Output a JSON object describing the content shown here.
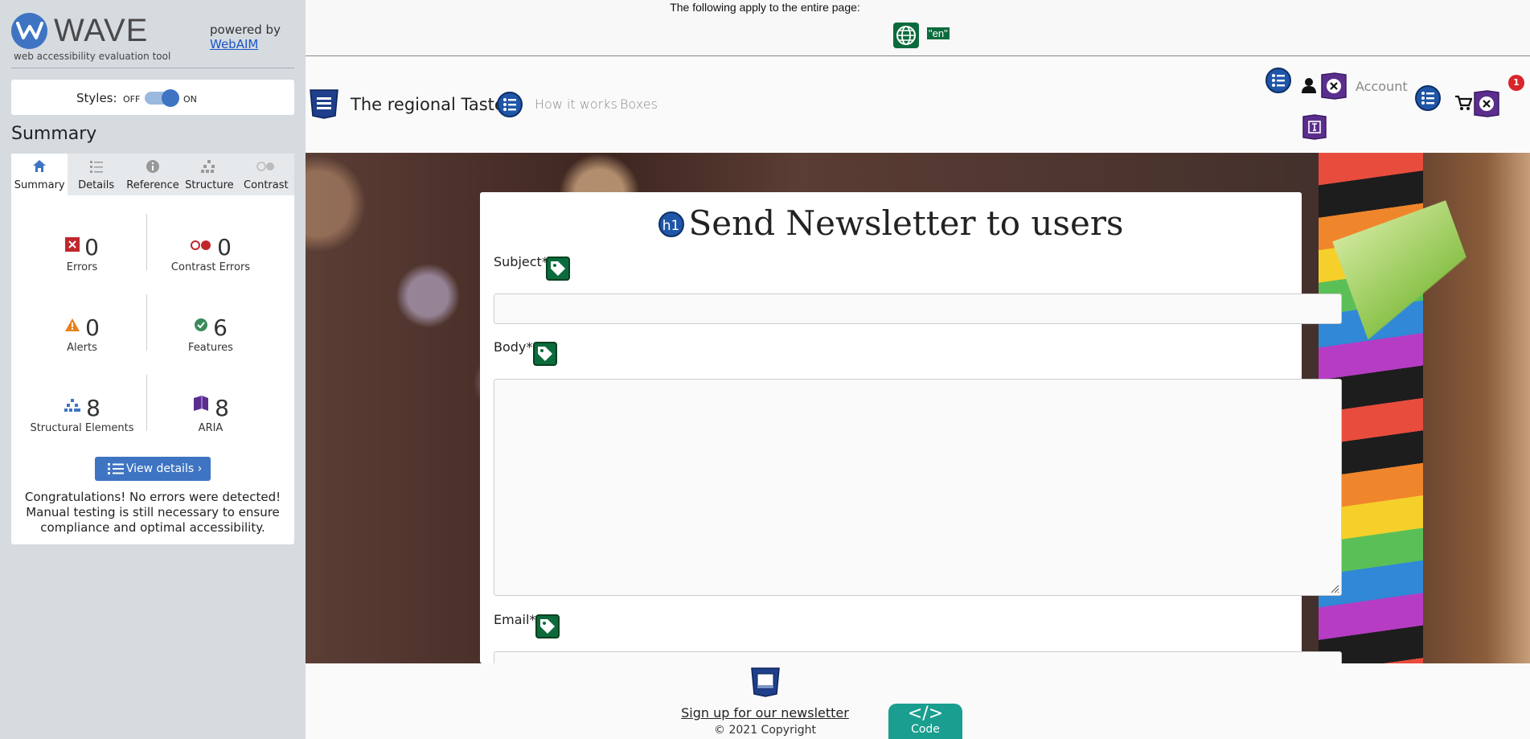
{
  "wave": {
    "title": "WAVE",
    "tagline": "web accessibility evaluation tool",
    "powered_by": "powered by",
    "webaim_link": "WebAIM",
    "styles_label": "Styles:",
    "styles_off": "OFF",
    "styles_on": "ON",
    "summary_title": "Summary",
    "tabs": [
      {
        "label": "Summary",
        "icon": "home-icon"
      },
      {
        "label": "Details",
        "icon": "list-icon"
      },
      {
        "label": "Reference",
        "icon": "info-icon"
      },
      {
        "label": "Structure",
        "icon": "structure-icon"
      },
      {
        "label": "Contrast",
        "icon": "contrast-icon"
      }
    ],
    "stats": {
      "errors": {
        "count": "0",
        "label": "Errors"
      },
      "contrast_errors": {
        "count": "0",
        "label": "Contrast Errors"
      },
      "alerts": {
        "count": "0",
        "label": "Alerts"
      },
      "features": {
        "count": "6",
        "label": "Features"
      },
      "structural": {
        "count": "8",
        "label": "Structural Elements"
      },
      "aria": {
        "count": "8",
        "label": "ARIA"
      }
    },
    "view_details": "View details ›",
    "congrats": "Congratulations! No errors were detected! Manual testing is still necessary to ensure compliance and optimal accessibility.",
    "colors": {
      "accent": "#3e74c2",
      "error": "#c0272d",
      "alert": "#e8811a",
      "feature": "#3a8a5a",
      "aria": "#5b2e8e"
    }
  },
  "page": {
    "applies_text": "The following apply to the entire page:",
    "lang_badge": "\"en\"",
    "brand": "The regional Taste",
    "nav": {
      "how_it_works": "How it works",
      "boxes": "Boxes",
      "account": "Account"
    },
    "cart_count": "1",
    "form": {
      "title": "Send Newsletter to users",
      "h1_badge": "h1",
      "subject_label": "Subject*",
      "body_label": "Body*",
      "email_label": "Email*"
    },
    "footer": {
      "newsletter_link": "Sign up for our newsletter",
      "copyright": "© 2021 Copyright",
      "code_symbol": "</>",
      "code_label": "Code"
    },
    "colors": {
      "feature_green": "#0c6b3c",
      "code_teal": "#1a9e8f"
    }
  }
}
